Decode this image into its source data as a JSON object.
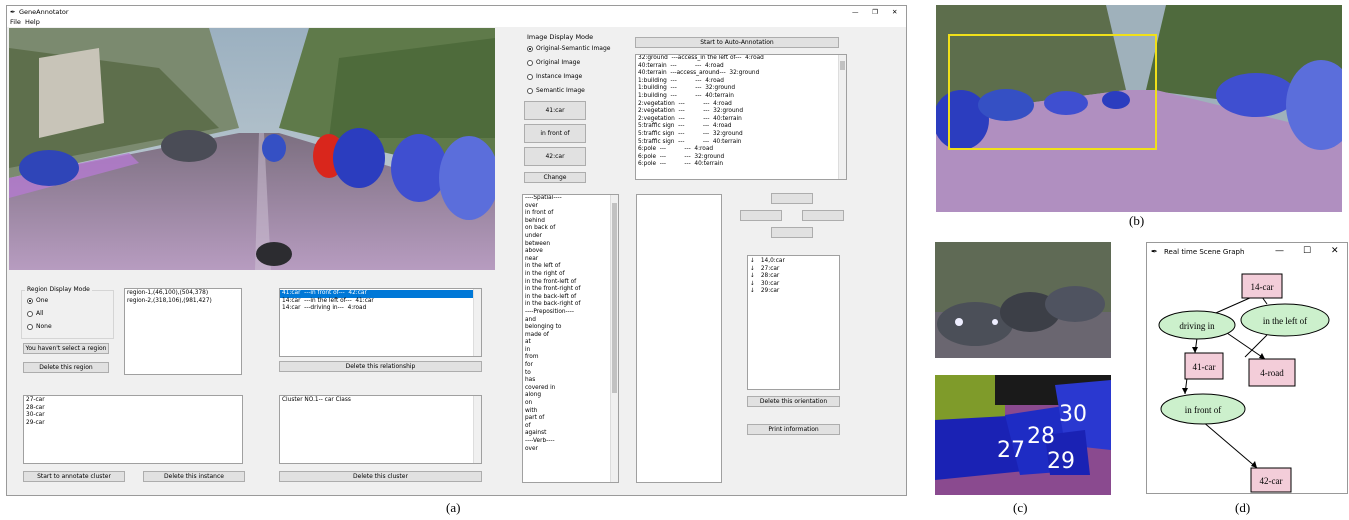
{
  "window": {
    "title": "GeneAnnotator",
    "menu": [
      "File",
      "Help"
    ],
    "controls": [
      "—",
      "❐",
      "✕"
    ]
  },
  "display_mode": {
    "title": "Image Display Mode",
    "options": [
      "Original-Semantic Image",
      "Original Image",
      "Instance Image",
      "Semantic Image"
    ],
    "selected": 0
  },
  "selection_buttons": {
    "subject": "41:car",
    "relation": "in front of",
    "object": "42:car",
    "change": "Change"
  },
  "auto_annotation_button": "Start to Auto-Annotation",
  "relation_list": [
    "32:ground  ---access_in the left of---  4:road",
    "40:terrain  ---          ---  4:road",
    "40:terrain  ---access_around---  32:ground",
    "1:building  ---          ---  4:road",
    "1:building  ---          ---  32:ground",
    "1:building  ---          ---  40:terrain",
    "2:vegetation  ---          ---  4:road",
    "2:vegetation  ---          ---  32:ground",
    "2:vegetation  ---          ---  40:terrain",
    "5:traffic sign  ---          ---  4:road",
    "5:traffic sign  ---          ---  32:ground",
    "5:traffic sign  ---          ---  40:terrain",
    "6:pole  ---          ---  4:road",
    "6:pole  ---          ---  32:ground",
    "6:pole  ---          ---  40:terrain"
  ],
  "predicate_list": [
    "----Spatial----",
    "over",
    "in front of",
    "behind",
    "on back of",
    "under",
    "between",
    "above",
    "near",
    "in the left of",
    "in the right of",
    "in the front-left of",
    "in the front-right of",
    "in the back-left of",
    "in the back-right of",
    "----Preposition----",
    "and",
    "belonging to",
    "made of",
    "at",
    "in",
    "from",
    "for",
    "to",
    "has",
    "covered in",
    "along",
    "on",
    "with",
    "part of",
    "of",
    "against",
    "----Verb----",
    "over"
  ],
  "region": {
    "title": "Region Display Mode",
    "options": [
      "One",
      "All",
      "None"
    ],
    "selected": 0,
    "list": [
      "region-1,(46,100),(504,378)",
      "region-2,(318,106),(981,427)"
    ],
    "select_button": "You haven't select a region",
    "delete_button": "Delete this region"
  },
  "relationships": {
    "items": [
      "41:car  ---in front of---  42:car",
      "14:car  ---in the left of---  41:car",
      "14:car  ---driving in---  4:road"
    ],
    "selected": 0,
    "delete_button": "Delete this relationship"
  },
  "instances": {
    "items": [
      "27-car",
      "28-car",
      "30-car",
      "29-car"
    ],
    "annotate_button": "Start to annotate cluster",
    "delete_button": "Delete this instance"
  },
  "clusters": {
    "items": [
      "Cluster NO.1-- car Class"
    ],
    "delete_button": "Delete this cluster"
  },
  "orientation": {
    "items": [
      "14,0:car",
      "27:car",
      "28:car",
      "30:car",
      "29:car"
    ],
    "arrow": "↓",
    "delete_button": "Delete this orientation",
    "print_button": "Print information"
  },
  "scene_graph": {
    "title": "Real time Scene Graph",
    "controls": [
      "—",
      "☐",
      "✕"
    ],
    "nodes": {
      "n14": "14-car",
      "drive": "driving in",
      "left": "in the left of",
      "n41": "41-car",
      "road": "4-road",
      "front": "in front of",
      "n42": "42-car"
    }
  },
  "instance_labels": [
    "30",
    "28",
    "27",
    "29"
  ],
  "captions": [
    "(a)",
    "(b)",
    "(c)",
    "(d)"
  ],
  "colors": {
    "car_mask": "#2b3dbf",
    "red_car": "#d9261c",
    "road_mask": "#b08fc0",
    "node_fill": "#f3cdd9",
    "edge_fill": "#ccf0cc",
    "selection": "#0078d7",
    "bbox": "#f0e01a"
  }
}
